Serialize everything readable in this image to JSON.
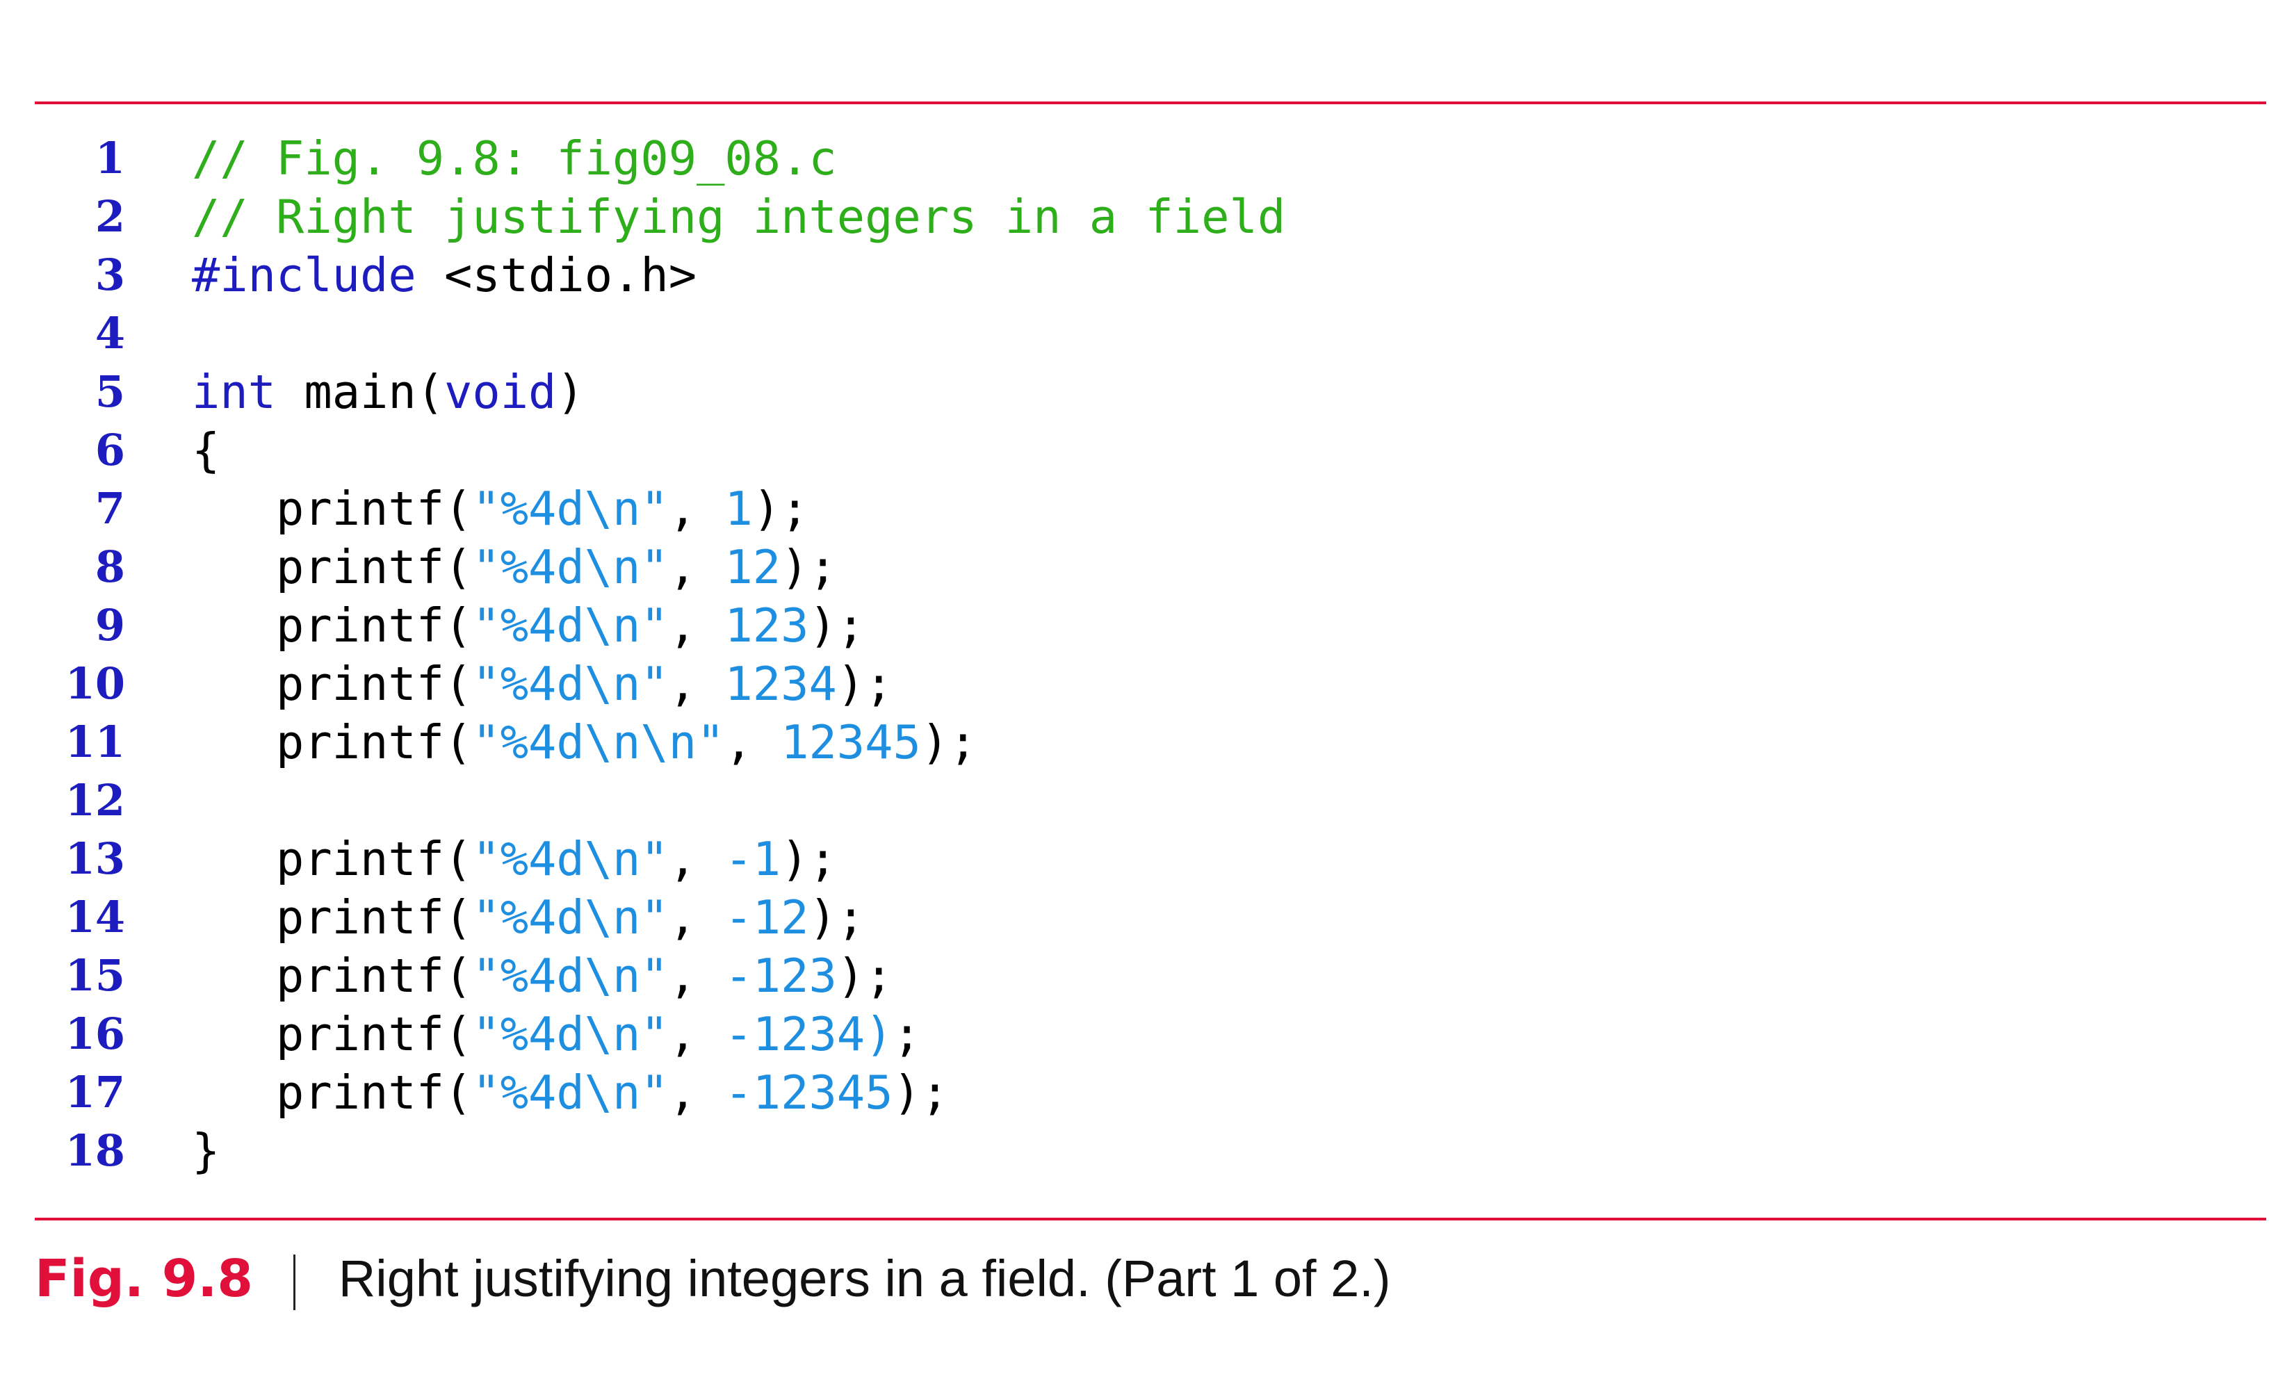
{
  "figure": {
    "label": "Fig. 9.8",
    "caption": "Right justifying integers in a field. (Part 1 of 2.)"
  },
  "colors": {
    "rule": "#e0103a",
    "line_number": "#1c1cbf",
    "comment": "#2fae1c",
    "keyword": "#1c1cbf",
    "literal": "#1e8fe0",
    "plain": "#000000"
  },
  "code_lines": [
    {
      "num": "1",
      "tokens": [
        {
          "t": "// Fig. 9.8: fig09_08.c",
          "c": "comment"
        }
      ]
    },
    {
      "num": "2",
      "tokens": [
        {
          "t": "// Right justifying integers in a field",
          "c": "comment"
        }
      ]
    },
    {
      "num": "3",
      "tokens": [
        {
          "t": "#include",
          "c": "keyword"
        },
        {
          "t": " <stdio.h>",
          "c": "plain"
        }
      ]
    },
    {
      "num": "4",
      "tokens": []
    },
    {
      "num": "5",
      "tokens": [
        {
          "t": "int",
          "c": "keyword"
        },
        {
          "t": " main(",
          "c": "plain"
        },
        {
          "t": "void",
          "c": "keyword"
        },
        {
          "t": ")",
          "c": "plain"
        }
      ]
    },
    {
      "num": "6",
      "tokens": [
        {
          "t": "{",
          "c": "plain"
        }
      ]
    },
    {
      "num": "7",
      "tokens": [
        {
          "t": "   printf(",
          "c": "plain"
        },
        {
          "t": "\"%4d\\n\"",
          "c": "literal"
        },
        {
          "t": ", ",
          "c": "plain"
        },
        {
          "t": "1",
          "c": "literal"
        },
        {
          "t": ");",
          "c": "plain"
        }
      ]
    },
    {
      "num": "8",
      "tokens": [
        {
          "t": "   printf(",
          "c": "plain"
        },
        {
          "t": "\"%4d\\n\"",
          "c": "literal"
        },
        {
          "t": ", ",
          "c": "plain"
        },
        {
          "t": "12",
          "c": "literal"
        },
        {
          "t": ");",
          "c": "plain"
        }
      ]
    },
    {
      "num": "9",
      "tokens": [
        {
          "t": "   printf(",
          "c": "plain"
        },
        {
          "t": "\"%4d\\n\"",
          "c": "literal"
        },
        {
          "t": ", ",
          "c": "plain"
        },
        {
          "t": "123",
          "c": "literal"
        },
        {
          "t": ");",
          "c": "plain"
        }
      ]
    },
    {
      "num": "10",
      "tokens": [
        {
          "t": "   printf(",
          "c": "plain"
        },
        {
          "t": "\"%4d\\n\"",
          "c": "literal"
        },
        {
          "t": ", ",
          "c": "plain"
        },
        {
          "t": "1234",
          "c": "literal"
        },
        {
          "t": ");",
          "c": "plain"
        }
      ]
    },
    {
      "num": "11",
      "tokens": [
        {
          "t": "   printf(",
          "c": "plain"
        },
        {
          "t": "\"%4d\\n\\n\"",
          "c": "literal"
        },
        {
          "t": ", ",
          "c": "plain"
        },
        {
          "t": "12345",
          "c": "literal"
        },
        {
          "t": ");",
          "c": "plain"
        }
      ]
    },
    {
      "num": "12",
      "tokens": []
    },
    {
      "num": "13",
      "tokens": [
        {
          "t": "   printf(",
          "c": "plain"
        },
        {
          "t": "\"%4d\\n\"",
          "c": "literal"
        },
        {
          "t": ", ",
          "c": "plain"
        },
        {
          "t": "-1",
          "c": "literal"
        },
        {
          "t": ");",
          "c": "plain"
        }
      ]
    },
    {
      "num": "14",
      "tokens": [
        {
          "t": "   printf(",
          "c": "plain"
        },
        {
          "t": "\"%4d\\n\"",
          "c": "literal"
        },
        {
          "t": ", ",
          "c": "plain"
        },
        {
          "t": "-12",
          "c": "literal"
        },
        {
          "t": ");",
          "c": "plain"
        }
      ]
    },
    {
      "num": "15",
      "tokens": [
        {
          "t": "   printf(",
          "c": "plain"
        },
        {
          "t": "\"%4d\\n\"",
          "c": "literal"
        },
        {
          "t": ", ",
          "c": "plain"
        },
        {
          "t": "-123",
          "c": "literal"
        },
        {
          "t": ");",
          "c": "plain"
        }
      ]
    },
    {
      "num": "16",
      "tokens": [
        {
          "t": "   printf(",
          "c": "plain"
        },
        {
          "t": "\"%4d\\n\"",
          "c": "literal"
        },
        {
          "t": ", ",
          "c": "plain"
        },
        {
          "t": "-1234)",
          "c": "literal"
        },
        {
          "t": ";",
          "c": "plain"
        }
      ]
    },
    {
      "num": "17",
      "tokens": [
        {
          "t": "   printf(",
          "c": "plain"
        },
        {
          "t": "\"%4d\\n\"",
          "c": "literal"
        },
        {
          "t": ", ",
          "c": "plain"
        },
        {
          "t": "-12345",
          "c": "literal"
        },
        {
          "t": ");",
          "c": "plain"
        }
      ]
    },
    {
      "num": "18",
      "tokens": [
        {
          "t": "}",
          "c": "plain"
        }
      ]
    }
  ]
}
